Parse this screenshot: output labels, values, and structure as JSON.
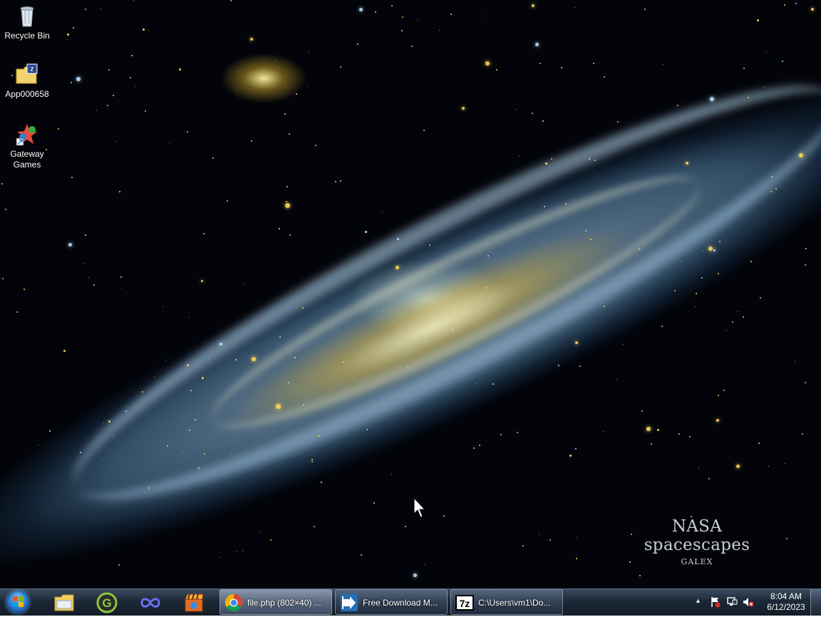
{
  "desktop": {
    "icons": [
      {
        "label": "Recycle Bin",
        "icon": "recycle-bin-icon"
      },
      {
        "label": "App000658",
        "icon": "folder-archive-icon"
      },
      {
        "label": "Gateway Games",
        "icon": "gateway-games-icon"
      }
    ],
    "wallpaper": {
      "title": "NASA spacescapes",
      "subtitle": "GALEX"
    }
  },
  "taskbar": {
    "start_icon": "windows-start-orb",
    "pinned": [
      {
        "name": "file-explorer",
        "icon": "folder-icon"
      },
      {
        "name": "greenshot",
        "icon": "g-logo-icon"
      },
      {
        "name": "infinity-app",
        "icon": "infinity-icon"
      },
      {
        "name": "media-app",
        "icon": "clapper-icon"
      }
    ],
    "tasks": [
      {
        "label": "file.php (802×40) ...",
        "icon": "chrome-icon",
        "active": true
      },
      {
        "label": "Free Download M...",
        "icon": "download-manager-icon",
        "active": false
      },
      {
        "label": "C:\\Users\\vm1\\Do...",
        "icon": "7zip-icon",
        "active": false
      }
    ],
    "tray": {
      "time": "8:04 AM",
      "date": "6/12/2023",
      "icons": [
        "show-hidden-arrow",
        "action-center-flag-icon",
        "network-icon",
        "volume-muted-icon"
      ]
    }
  },
  "colors": {
    "taskbar": "#1c2836",
    "accent": "#2f7fd4"
  }
}
